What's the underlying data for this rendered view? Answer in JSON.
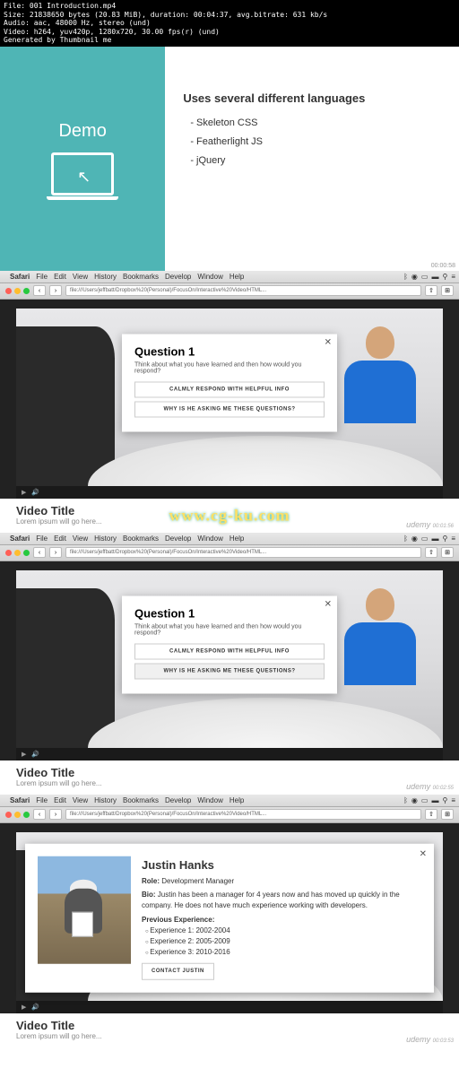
{
  "file_info": [
    "File: 001 Introduction.mp4",
    "Size: 21838650 bytes (20.83 MiB), duration: 00:04:37, avg.bitrate: 631 kb/s",
    "Audio: aac, 48000 Hz, stereo (und)",
    "Video: h264, yuv420p, 1280x720, 30.00 fps(r) (und)",
    "Generated by Thumbnail me"
  ],
  "slide1": {
    "title": "Demo",
    "heading": "Uses several different languages",
    "items": [
      "- Skeleton CSS",
      "- Featherlight JS",
      "- jQuery"
    ],
    "timestamp": "00:00:58"
  },
  "menubar": {
    "app": "Safari",
    "items": [
      "File",
      "Edit",
      "View",
      "History",
      "Bookmarks",
      "Develop",
      "Window",
      "Help"
    ],
    "url": "file:///Users/jeffbatt/Dropbox%20(Personal)/FocusOn/Interactive%20Video/HTML..."
  },
  "question_modal": {
    "title": "Question 1",
    "prompt": "Think about what you have learned and then how would you respond?",
    "btn1": "CALMLY RESPOND WITH HELPFUL INFO",
    "btn2": "WHY IS HE ASKING ME THESE QUESTIONS?"
  },
  "video_meta": {
    "title": "Video Title",
    "sub": "Lorem ipsum will go here..."
  },
  "watermark": "www.cg-ku.com",
  "udemy": "udemy",
  "timestamps": {
    "f2": "00:01:56",
    "f3": "00:02:55",
    "f4": "00:03:53"
  },
  "bio": {
    "name": "Justin Hanks",
    "role_label": "Role:",
    "role": "Development Manager",
    "bio_label": "Bio:",
    "bio": "Justin has been a manager for 4 years now and has moved up quickly in the company. He does not have much experience working with developers.",
    "prev_label": "Previous Experience:",
    "exp": [
      "Experience 1: 2002-2004",
      "Experience 2: 2005-2009",
      "Experience 3: 2010-2016"
    ],
    "contact": "CONTACT JUSTIN"
  }
}
